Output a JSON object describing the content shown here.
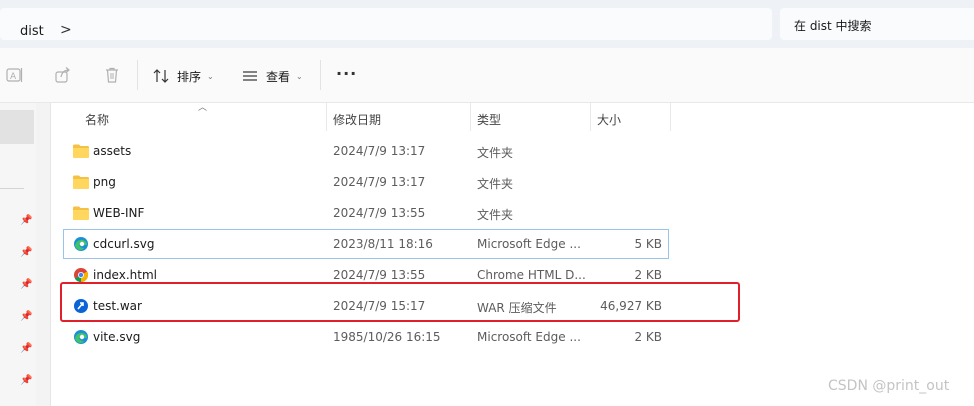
{
  "address": {
    "folder": "dist",
    "separator": ">",
    "search_placeholder": "在 dist 中搜索"
  },
  "toolbar": {
    "sort_label": "排序",
    "view_label": "查看",
    "more_label": "···",
    "caret": "⌄"
  },
  "columns": {
    "name": "名称",
    "date": "修改日期",
    "type": "类型",
    "size": "大小"
  },
  "files": [
    {
      "name": "assets",
      "date": "2024/7/9 13:17",
      "type": "文件夹",
      "size": "",
      "icon": "folder-icon"
    },
    {
      "name": "png",
      "date": "2024/7/9 13:17",
      "type": "文件夹",
      "size": "",
      "icon": "folder-icon"
    },
    {
      "name": "WEB-INF",
      "date": "2024/7/9 13:55",
      "type": "文件夹",
      "size": "",
      "icon": "folder-icon"
    },
    {
      "name": "cdcurl.svg",
      "date": "2023/8/11 18:16",
      "type": "Microsoft Edge ...",
      "size": "5 KB",
      "icon": "edge-icon"
    },
    {
      "name": "index.html",
      "date": "2024/7/9 13:55",
      "type": "Chrome HTML D...",
      "size": "2 KB",
      "icon": "chrome-icon"
    },
    {
      "name": "test.war",
      "date": "2024/7/9 15:17",
      "type": "WAR 压缩文件",
      "size": "46,927 KB",
      "icon": "war-archive-icon"
    },
    {
      "name": "vite.svg",
      "date": "1985/10/26 16:15",
      "type": "Microsoft Edge ...",
      "size": "2 KB",
      "icon": "edge-icon"
    }
  ],
  "watermark": "CSDN @print_out",
  "colors": {
    "highlight": "#e0202a",
    "hover_border": "#99c5ea",
    "folder": "#f5c142",
    "accent": "#0a64d6"
  }
}
